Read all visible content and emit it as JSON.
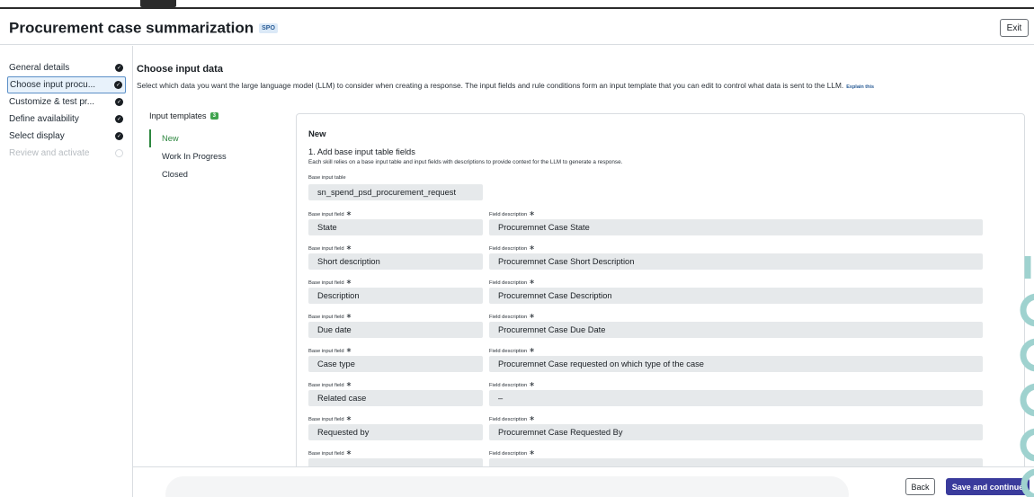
{
  "header": {
    "title": "Procurement case summarization",
    "badge": "SPO",
    "exit_label": "Exit"
  },
  "sidebar": {
    "items": [
      {
        "label": "General details",
        "status": "complete"
      },
      {
        "label": "Choose input procu...",
        "status": "complete",
        "active": true
      },
      {
        "label": "Customize & test pr...",
        "status": "complete"
      },
      {
        "label": "Define availability",
        "status": "complete"
      },
      {
        "label": "Select display",
        "status": "complete"
      },
      {
        "label": "Review and activate",
        "status": "disabled"
      }
    ]
  },
  "main": {
    "section_title": "Choose input data",
    "section_description": "Select which data you want the large language model (LLM) to consider when creating a response. The input fields and rule conditions form an input template that you can edit to control what data is sent to the LLM.",
    "explain_link": "Explain this",
    "templates_heading": "Input templates",
    "templates_count": "3",
    "templates": [
      {
        "label": "New",
        "active": true
      },
      {
        "label": "Work In Progress"
      },
      {
        "label": "Closed"
      }
    ]
  },
  "card": {
    "title": "New",
    "step_title": "1. Add base input table fields",
    "step_description": "Each skill relies on a base input table and input fields with descriptions to provide context for the LLM to generate a response.",
    "base_table_label": "Base input table",
    "base_table_value": "sn_spend_psd_procurement_request",
    "field_label": "Base input field",
    "desc_label": "Field description",
    "required_mark": "∗",
    "rows": [
      {
        "field": "State",
        "description": "Procuremnet Case State"
      },
      {
        "field": "Short description",
        "description": "Procuremnet Case Short Description"
      },
      {
        "field": "Description",
        "description": "Procuremnet Case Description"
      },
      {
        "field": "Due date",
        "description": "Procuremnet Case Due Date"
      },
      {
        "field": "Case type",
        "description": "Procuremnet Case requested on which type of the case"
      },
      {
        "field": "Related case",
        "description": "–"
      },
      {
        "field": "Requested by",
        "description": "Procuremnet Case Requested By"
      },
      {
        "field": "",
        "description": ""
      }
    ]
  },
  "footer": {
    "back_label": "Back",
    "save_label": "Save and continue"
  },
  "colors": {
    "accent_green": "#2e8740",
    "primary_button": "#3a3b9c",
    "active_nav_bg": "#e8f2fb",
    "deco_teal": "#9fd2cf"
  },
  "icons": {
    "complete": "check-circle-icon",
    "disabled": "empty-circle-icon"
  }
}
